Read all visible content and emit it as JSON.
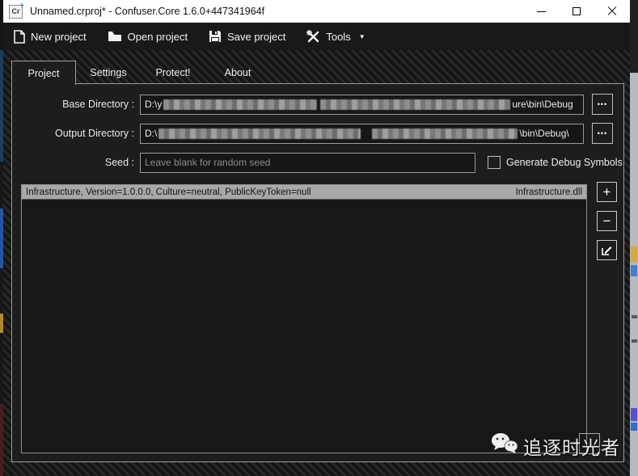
{
  "window": {
    "title": "Unnamed.crproj* - Confuser.Core 1.6.0+447341964f",
    "app_icon_text": "Cr",
    "app_icon_plus": "+"
  },
  "toolbar": {
    "items": [
      {
        "label": "New project",
        "icon": "new-document-icon"
      },
      {
        "label": "Open project",
        "icon": "open-folder-icon"
      },
      {
        "label": "Save project",
        "icon": "save-floppy-icon"
      },
      {
        "label": "Tools",
        "icon": "tools-icon",
        "caret": "▼"
      }
    ]
  },
  "tabs": [
    {
      "label": "Project",
      "active": true
    },
    {
      "label": "Settings",
      "active": false
    },
    {
      "label": "Protect!",
      "active": false
    },
    {
      "label": "About",
      "active": false
    }
  ],
  "form": {
    "base_directory": {
      "label": "Base Directory :",
      "value_prefix": "D:\\y",
      "value_suffix": "ure\\bin\\Debug",
      "redacted": true
    },
    "output_directory": {
      "label": "Output Directory :",
      "value_prefix": "D:\\",
      "value_suffix": "\\bin\\Debug\\",
      "redacted": true
    },
    "seed": {
      "label": "Seed :",
      "value": "",
      "placeholder": "Leave blank for random seed"
    },
    "debug_symbols": {
      "label": "Generate Debug Symbols",
      "checked": false
    },
    "browse_glyph": "•••"
  },
  "module_list": {
    "rows": [
      {
        "assembly": "Infrastructure, Version=1.0.0.0, Culture=neutral, PublicKeyToken=null",
        "file": "Infrastructure.dll",
        "selected": true
      }
    ],
    "buttons": {
      "add": "+",
      "remove": "−",
      "edit": "edit-pencil-icon"
    }
  },
  "watermark": {
    "text": "追逐时光者",
    "icon": "wechat-icon"
  },
  "colors": {
    "accent_blue": "#2f7fe8",
    "selected_row": "#a8a8a8",
    "panel": "#1d1d1d",
    "titlebar": "#ffffff"
  }
}
